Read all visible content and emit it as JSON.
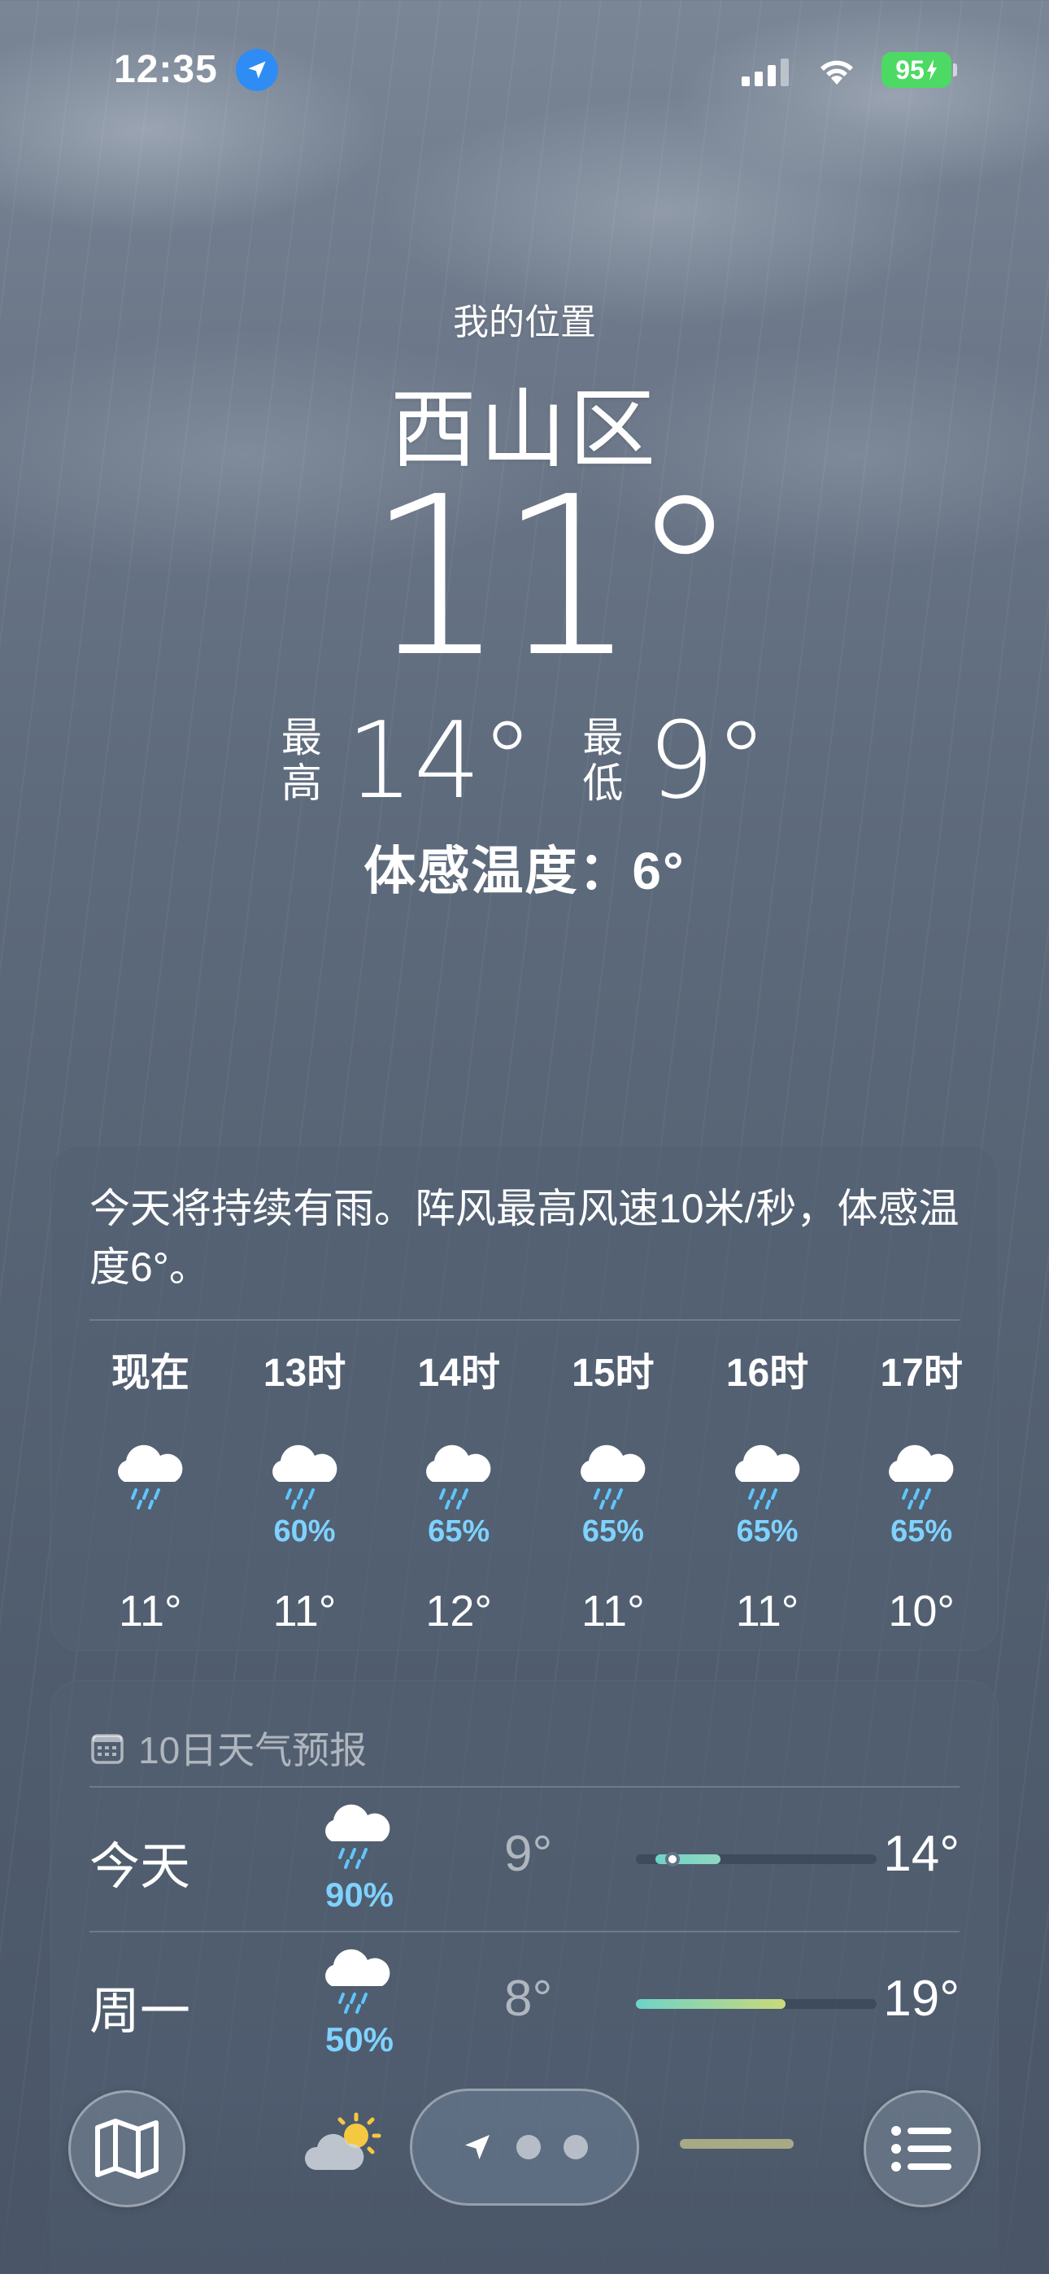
{
  "status_bar": {
    "time": "12:35",
    "battery": "95"
  },
  "location": {
    "label": "我的位置",
    "city": "西山区"
  },
  "current": {
    "temp": "11°",
    "high_label_1": "最",
    "high_label_2": "高",
    "high": "14°",
    "low_label_1": "最",
    "low_label_2": "低",
    "low": "9°",
    "feels_like": "体感温度：6°"
  },
  "hourly": {
    "summary": "今天将持续有雨。阵风最高风速10米/秒，体感温度6°。",
    "items": [
      {
        "label": "现在",
        "pct": "",
        "temp": "11°"
      },
      {
        "label": "13时",
        "pct": "60%",
        "temp": "11°"
      },
      {
        "label": "14时",
        "pct": "65%",
        "temp": "12°"
      },
      {
        "label": "15时",
        "pct": "65%",
        "temp": "11°"
      },
      {
        "label": "16时",
        "pct": "65%",
        "temp": "11°"
      },
      {
        "label": "17时",
        "pct": "65%",
        "temp": "10°"
      }
    ]
  },
  "daily": {
    "title": "10日天气预报",
    "days": [
      {
        "name": "今天",
        "pct": "90%",
        "low": "9°",
        "high": "14°",
        "range_start": 0.08,
        "range_end": 0.35,
        "current_pos": 0.12,
        "fill": "linear-gradient(90deg,#6fd3c8,#8fd7c0)"
      },
      {
        "name": "周一",
        "pct": "50%",
        "low": "8°",
        "high": "19°",
        "range_start": 0.0,
        "range_end": 0.62,
        "current_pos": null,
        "fill": "linear-gradient(90deg,#6fd3c8,#c9d97a)"
      }
    ]
  },
  "bottom_bar": {
    "icons": [
      "map-icon",
      "location-arrow-icon",
      "list-icon"
    ]
  }
}
